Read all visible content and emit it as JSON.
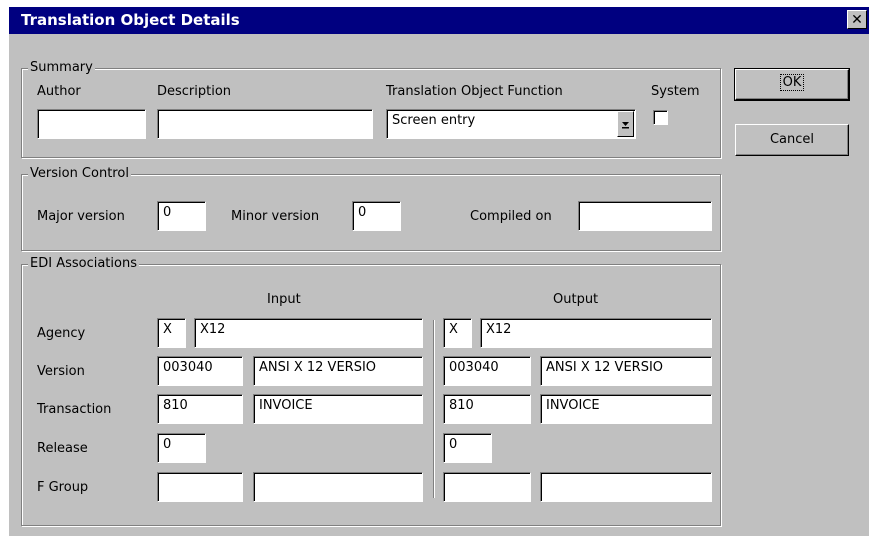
{
  "window": {
    "title": "Translation Object Details",
    "close_glyph": "✕"
  },
  "buttons": {
    "ok": "OK",
    "cancel": "Cancel"
  },
  "summary": {
    "legend": "Summary",
    "author_label": "Author",
    "author_value": "",
    "description_label": "Description",
    "description_value": "",
    "function_label": "Translation Object Function",
    "function_value": "Screen entry",
    "system_label": "System",
    "system_checked": false
  },
  "version_control": {
    "legend": "Version Control",
    "major_label": "Major version",
    "major_value": "0",
    "minor_label": "Minor version",
    "minor_value": "0",
    "compiled_label": "Compiled on",
    "compiled_value": ""
  },
  "edi": {
    "legend": "EDI Associations",
    "input_header": "Input",
    "output_header": "Output",
    "rows": {
      "agency": {
        "label": "Agency",
        "input_code": "X",
        "input_desc": "X12",
        "output_code": "X",
        "output_desc": "X12"
      },
      "version": {
        "label": "Version",
        "input_code": "003040",
        "input_desc": "ANSI X 12 VERSIO",
        "output_code": "003040",
        "output_desc": "ANSI X 12 VERSIO"
      },
      "transaction": {
        "label": "Transaction",
        "input_code": "810",
        "input_desc": "INVOICE",
        "output_code": "810",
        "output_desc": "INVOICE"
      },
      "release": {
        "label": "Release",
        "input_code": "0",
        "output_code": "0"
      },
      "fgroup": {
        "label": "F Group",
        "input_code": "",
        "input_desc": "",
        "output_code": "",
        "output_desc": ""
      }
    }
  },
  "icons": {
    "dropdown": "dropdown-arrow-icon",
    "close": "close-icon"
  }
}
